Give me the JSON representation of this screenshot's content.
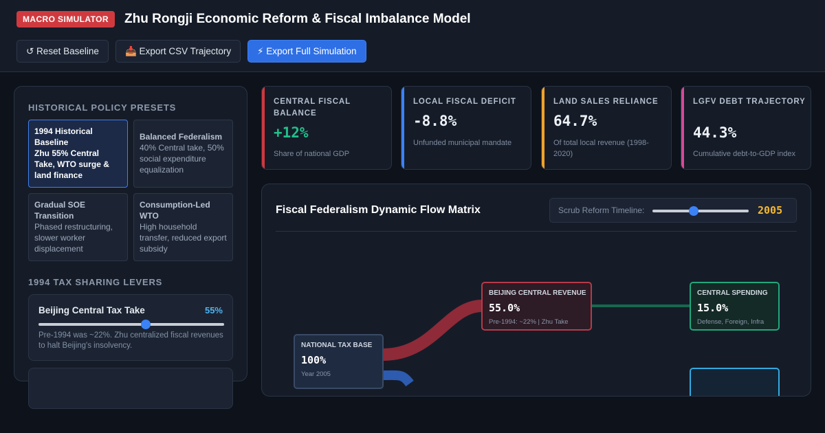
{
  "header": {
    "badge": "MACRO SIMULATOR",
    "title": "Zhu Rongji Economic Reform & Fiscal Imbalance Model",
    "buttons": {
      "reset": "↺ Reset Baseline",
      "export_csv": "📥 Export CSV Trajectory",
      "export_full": "⚡ Export Full Simulation"
    }
  },
  "sidebar": {
    "presets_heading": "Historical Policy Presets",
    "presets": [
      {
        "title": "1994 Historical Baseline",
        "desc": "Zhu 55% Central Take, WTO surge & land finance",
        "active": true
      },
      {
        "title": "Balanced Federalism",
        "desc": "40% Central take, 50% social expenditure equalization",
        "active": false
      },
      {
        "title": "Gradual SOE Transition",
        "desc": "Phased restructuring, slower worker displacement",
        "active": false
      },
      {
        "title": "Consumption-Led WTO",
        "desc": "High household transfer, reduced export subsidy",
        "active": false
      }
    ],
    "levers_heading": "1994 Tax Sharing Levers",
    "levers": [
      {
        "name": "Beijing Central Tax Take",
        "value_label": "55%",
        "value": 55,
        "min": 20,
        "max": 80,
        "note": "Pre-1994 was ~22%. Zhu centralized fiscal revenues to halt Beijing's insolvency."
      }
    ]
  },
  "kpis": [
    {
      "label": "Central Fiscal Balance",
      "value": "+12%",
      "sub": "Share of national GDP",
      "color": "#d0373f",
      "value_color": "#22c08a"
    },
    {
      "label": "Local Fiscal Deficit",
      "value": "-8.8%",
      "sub": "Unfunded municipal mandate",
      "color": "#3b82f6",
      "value_color": "#eef2f7"
    },
    {
      "label": "Land Sales Reliance",
      "value": "64.7%",
      "sub": "Of total local revenue (1998-2020)",
      "color": "#f0a22a",
      "value_color": "#eef2f7"
    },
    {
      "label": "LGFV Debt Trajectory",
      "value": "44.3%",
      "sub": "Cumulative debt-to-GDP index",
      "color": "#d44a96",
      "value_color": "#eef2f7"
    }
  ],
  "flow": {
    "title": "Fiscal Federalism Dynamic Flow Matrix",
    "scrub_label": "Scrub Reform Timeline:",
    "year": "2005",
    "year_value": 2005,
    "year_min": 1994,
    "year_max": 2020,
    "nodes": {
      "national": {
        "title": "NATIONAL TAX BASE",
        "value": "100%",
        "sub": "Year 2005"
      },
      "central": {
        "title": "BEIJING CENTRAL REVENUE",
        "value": "55.0%",
        "sub": "Pre-1994: ~22% | Zhu Take"
      },
      "spending": {
        "title": "CENTRAL SPENDING",
        "value": "15.0%",
        "sub": "Defense, Foreign, Infra"
      }
    },
    "colors": {
      "central_flow": "#8f2a38",
      "local_flow": "#2d5bb0",
      "spend_flow": "#17684e"
    }
  }
}
